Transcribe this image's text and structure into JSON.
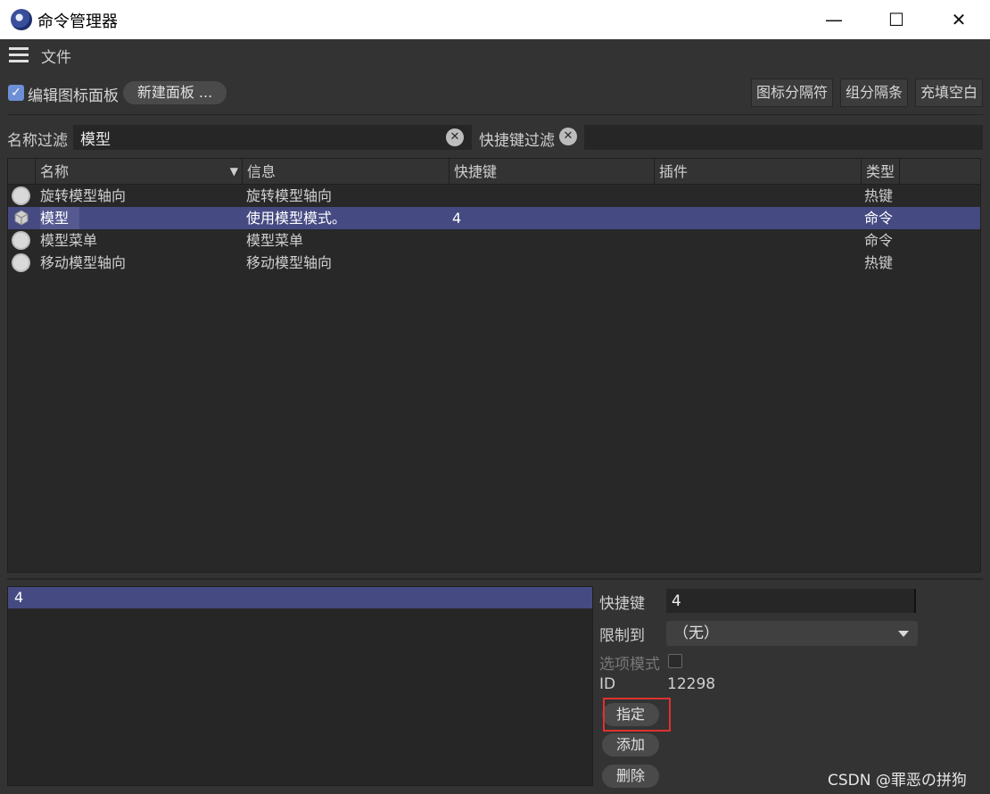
{
  "window": {
    "title": "命令管理器",
    "minimize": "—",
    "maximize": "☐",
    "close": "✕"
  },
  "menu": {
    "file": "文件"
  },
  "toolbar": {
    "edit_icon_panel": "编辑图标面板",
    "edit_icon_panel_checked": true,
    "new_panel": "新建面板 ...",
    "icon_separator": "图标分隔符",
    "group_separator": "组分隔条",
    "fill_space": "充填空白"
  },
  "filters": {
    "name_label": "名称过滤",
    "name_value": "模型",
    "shortcut_label": "快捷键过滤",
    "shortcut_value": "",
    "clear_symbol": "✕"
  },
  "table": {
    "columns": [
      "名称",
      "信息",
      "快捷键",
      "插件",
      "类型"
    ],
    "sort_indicator": "▼",
    "rows": [
      {
        "icon": "gear-icon",
        "name": "旋转模型轴向",
        "info": "旋转模型轴向",
        "shortcut": "",
        "plugin": "",
        "type": "热键",
        "selected": false
      },
      {
        "icon": "cube-icon",
        "name": "模型",
        "info": "使用模型模式。",
        "shortcut": "4",
        "plugin": "",
        "type": "命令",
        "selected": true
      },
      {
        "icon": "gear-icon",
        "name": "模型菜单",
        "info": "模型菜单",
        "shortcut": "",
        "plugin": "",
        "type": "命令",
        "selected": false
      },
      {
        "icon": "gear-icon",
        "name": "移动模型轴向",
        "info": "移动模型轴向",
        "shortcut": "",
        "plugin": "",
        "type": "热键",
        "selected": false
      }
    ]
  },
  "shortcut_list": {
    "items": [
      "4"
    ]
  },
  "properties": {
    "shortcut_label": "快捷键",
    "shortcut_value": "4",
    "restrict_label": "限制到",
    "restrict_value": "（无）",
    "option_mode_label": "选项模式",
    "id_label": "ID",
    "id_value": "12298"
  },
  "actions": {
    "assign": "指定",
    "add": "添加",
    "delete": "删除"
  },
  "watermark": "CSDN @罪恶の拼狗",
  "colors": {
    "background": "#333333",
    "selection": "#454a82",
    "highlight_box": "#e03030"
  }
}
